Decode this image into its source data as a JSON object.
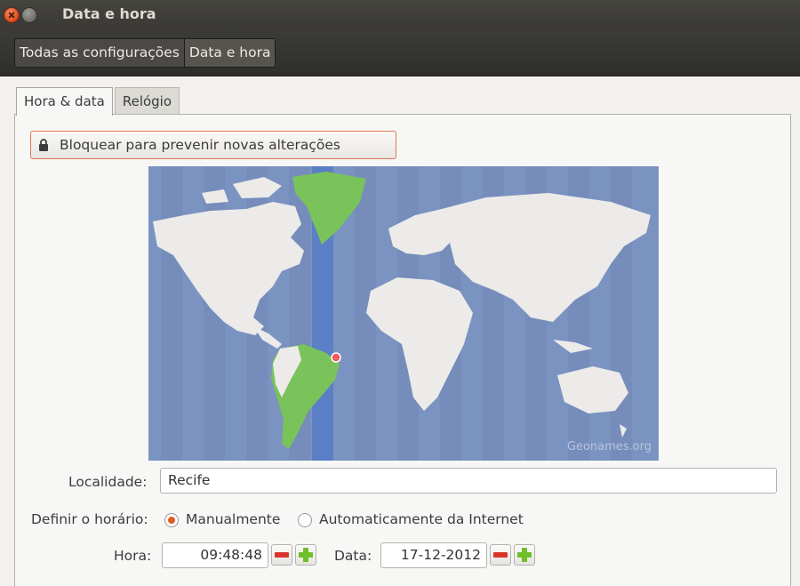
{
  "window": {
    "title": "Data e hora"
  },
  "breadcrumb": {
    "items": [
      "Todas as configurações",
      "Data e hora"
    ]
  },
  "tabs": [
    {
      "label": "Hora & data",
      "active": true
    },
    {
      "label": "Relógio",
      "active": false
    }
  ],
  "lock": {
    "label": "Bloquear para prevenir novas alterações",
    "icon": "lock-icon"
  },
  "map": {
    "credit": "Geonames.org",
    "selected_city": "Recife"
  },
  "location": {
    "label": "Localidade:",
    "value": "Recife"
  },
  "set_time": {
    "label": "Definir o horário:",
    "options": [
      {
        "label": "Manualmente",
        "selected": true
      },
      {
        "label": "Automaticamente da Internet",
        "selected": false
      }
    ]
  },
  "time": {
    "label": "Hora:",
    "value": "09:48:48"
  },
  "date": {
    "label": "Data:",
    "value": "17-12-2012"
  },
  "colors": {
    "accent": "#e25b25",
    "ocean": "#7b93c0",
    "highlight_zone": "#5a7fc6",
    "land": "#ecebe9",
    "tz_land": "#79c35a"
  }
}
